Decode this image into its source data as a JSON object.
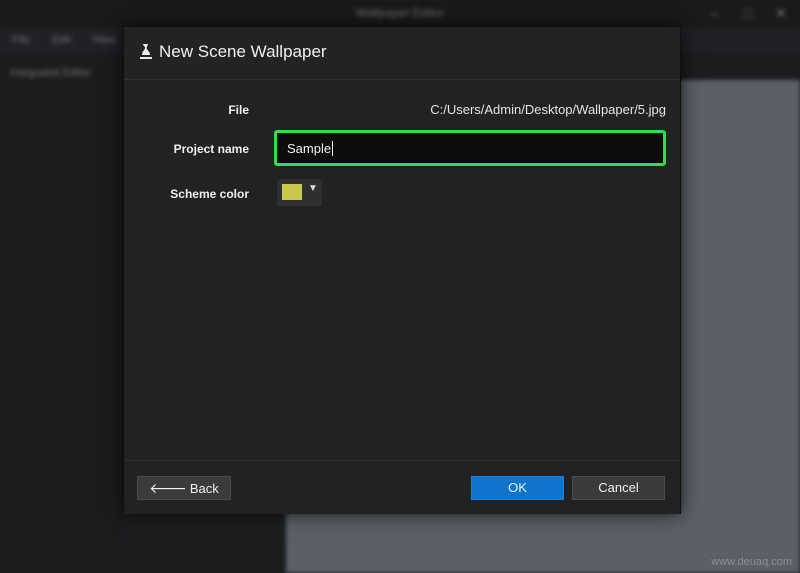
{
  "background": {
    "window_title": "Wallpaper Editor",
    "menu": [
      "File",
      "Edit",
      "View"
    ],
    "sidebar_item": "Integrated Editor",
    "window_controls": [
      "minimize",
      "maximize",
      "close"
    ]
  },
  "dialog": {
    "title": "New Scene Wallpaper",
    "icon": "wallpaper-engine-icon",
    "file_label": "File",
    "file_path": "C:/Users/Admin/Desktop/Wallpaper/5.jpg",
    "project_name_label": "Project name",
    "project_name_value": "Sample",
    "scheme_color_label": "Scheme color",
    "scheme_color": "#c8c84d",
    "focus_color": "#2ddf4c"
  },
  "footer": {
    "back_label": "Back",
    "ok_label": "OK",
    "cancel_label": "Cancel"
  },
  "watermark": "www.deuaq.com"
}
